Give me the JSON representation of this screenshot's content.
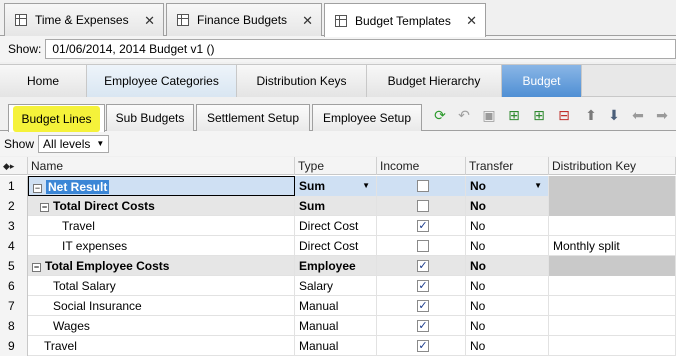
{
  "doc_tabs": [
    {
      "label": "Time & Expenses"
    },
    {
      "label": "Finance Budgets"
    },
    {
      "label": "Budget Templates"
    }
  ],
  "show_bar": {
    "label": "Show:",
    "value": "01/06/2014, 2014 Budget v1 ()"
  },
  "nav": [
    {
      "label": "Home"
    },
    {
      "label": "Employee Categories"
    },
    {
      "label": "Distribution Keys"
    },
    {
      "label": "Budget Hierarchy"
    },
    {
      "label": "Budget"
    }
  ],
  "sub_tabs": [
    {
      "label": "Budget Lines"
    },
    {
      "label": "Sub Budgets"
    },
    {
      "label": "Settlement Setup"
    },
    {
      "label": "Employee Setup"
    }
  ],
  "filter": {
    "label": "Show",
    "value": "All levels"
  },
  "grid": {
    "columns": [
      "Name",
      "Type",
      "Income",
      "Transfer",
      "Distribution Key"
    ],
    "rows": [
      {
        "num": "1",
        "name": "Net Result",
        "type": "Sum",
        "income": false,
        "transfer": "No",
        "dist_key": ""
      },
      {
        "num": "2",
        "name": "Total Direct Costs",
        "type": "Sum",
        "income": false,
        "transfer": "No",
        "dist_key": ""
      },
      {
        "num": "3",
        "name": "Travel",
        "type": "Direct Cost",
        "income": true,
        "transfer": "No",
        "dist_key": ""
      },
      {
        "num": "4",
        "name": "IT expenses",
        "type": "Direct Cost",
        "income": false,
        "transfer": "No",
        "dist_key": "Monthly split"
      },
      {
        "num": "5",
        "name": "Total Employee Costs",
        "type": "Employee",
        "income": true,
        "transfer": "No",
        "dist_key": ""
      },
      {
        "num": "6",
        "name": "Total Salary",
        "type": "Salary",
        "income": true,
        "transfer": "No",
        "dist_key": ""
      },
      {
        "num": "7",
        "name": "Social Insurance",
        "type": "Manual",
        "income": true,
        "transfer": "No",
        "dist_key": ""
      },
      {
        "num": "8",
        "name": "Wages",
        "type": "Manual",
        "income": true,
        "transfer": "No",
        "dist_key": ""
      },
      {
        "num": "9",
        "name": "Travel",
        "type": "Manual",
        "income": true,
        "transfer": "No",
        "dist_key": ""
      }
    ]
  },
  "colors": {
    "active_nav": "#4f8fd4",
    "highlight": "#f5f23a",
    "selection": "#3b86d6"
  }
}
